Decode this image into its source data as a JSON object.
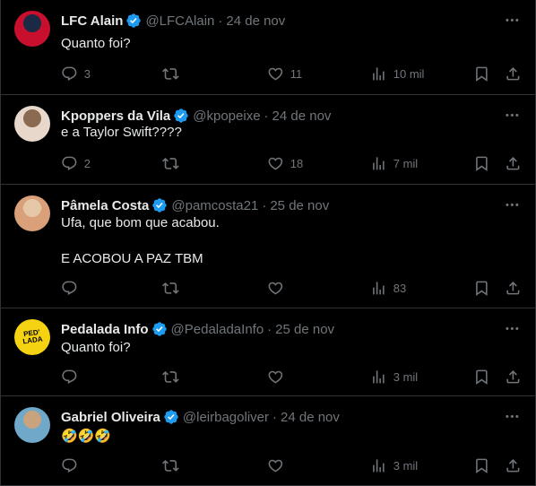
{
  "tweets": [
    {
      "name": "LFC Alain",
      "handle": "@LFCAlain",
      "date": "24 de nov",
      "text_lines": [
        "Quanto foi?"
      ],
      "replies": "3",
      "retweets": "",
      "likes": "11",
      "views": "10 mil",
      "avatar_colors": [
        "#c8102e",
        "#1a2a44"
      ]
    },
    {
      "name": "Kpoppers da Vila",
      "handle": "@kpopeixe",
      "date": "24 de nov",
      "text_lines": [
        "e a Taylor Swift????"
      ],
      "replies": "2",
      "retweets": "",
      "likes": "18",
      "views": "7 mil",
      "avatar_colors": [
        "#e8d8cc",
        "#8a6a50"
      ]
    },
    {
      "name": "Pâmela Costa",
      "handle": "@pamcosta21",
      "date": "25 de nov",
      "text_lines": [
        "Ufa, que bom que acabou.",
        "",
        "E ACOBOU A PAZ TBM"
      ],
      "replies": "",
      "retweets": "",
      "likes": "",
      "views": "83",
      "avatar_colors": [
        "#d9a07a",
        "#e6c7a8"
      ]
    },
    {
      "name": "Pedalada Info",
      "handle": "@PedaladaInfo",
      "date": "25 de nov",
      "text_lines": [
        "Quanto foi?"
      ],
      "replies": "",
      "retweets": "",
      "likes": "",
      "views": "3 mil",
      "avatar_colors": [
        "#f5d312",
        "#000000"
      ],
      "avatar_text": "PED'\nLADA"
    },
    {
      "name": "Gabriel Oliveira",
      "handle": "@leirbagoliver",
      "date": "24 de nov",
      "text_lines": [
        "🤣🤣🤣"
      ],
      "replies": "",
      "retweets": "",
      "likes": "",
      "views": "3 mil",
      "avatar_colors": [
        "#6fa8c8",
        "#c9a27e"
      ]
    }
  ],
  "colors": {
    "background": "#000000",
    "text": "#e7e9ea",
    "muted": "#71767b",
    "verified": "#1d9bf0",
    "divider": "#2f3336"
  }
}
